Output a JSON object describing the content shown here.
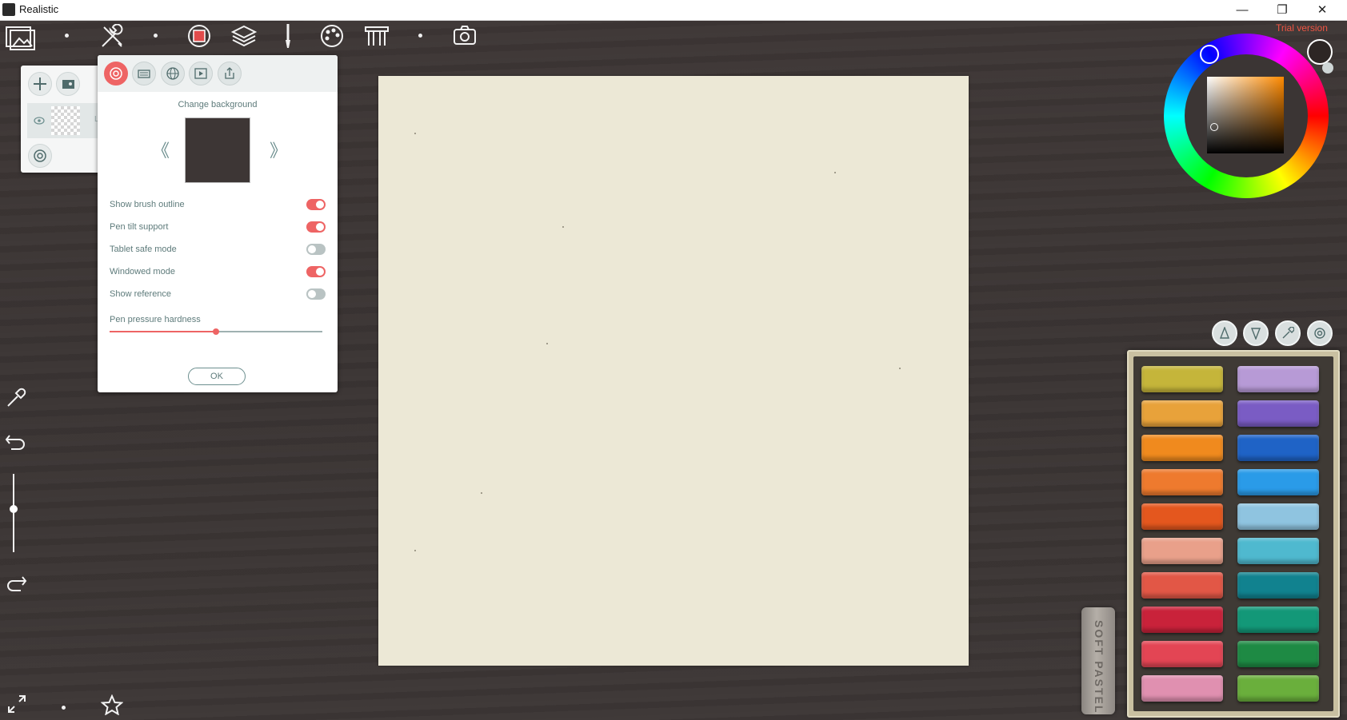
{
  "window": {
    "title": "Realistic",
    "min": "—",
    "max": "❐",
    "close": "✕"
  },
  "trial": "Trial version",
  "layers": {
    "layer_name": "Lay"
  },
  "settings": {
    "bg_label": "Change background",
    "prev": "《",
    "next": "》",
    "options": [
      {
        "label": "Show brush outline",
        "on": true
      },
      {
        "label": "Pen tilt support",
        "on": true
      },
      {
        "label": "Tablet safe mode",
        "on": false
      },
      {
        "label": "Windowed mode",
        "on": true
      },
      {
        "label": "Show reference",
        "on": false
      }
    ],
    "slider_label": "Pen pressure hardness",
    "slider_value": 0.5,
    "ok": "OK"
  },
  "colors": {
    "accent": "#ee6464",
    "current": "#2d2624",
    "canvas": "#ece8d6",
    "background": "#3b3534"
  },
  "pastels": {
    "left": [
      "#c5b53a",
      "#e8a23a",
      "#f08a1e",
      "#ee7a2e",
      "#e4571e",
      "#e9a08a",
      "#e25746",
      "#c9223a",
      "#e34554",
      "#e090b0"
    ],
    "right": [
      "#b79ad6",
      "#7a5cc4",
      "#1f63c6",
      "#2a9be8",
      "#8fc4e0",
      "#4fb9cf",
      "#11828f",
      "#139878",
      "#1e8a44",
      "#6aaf3c"
    ]
  },
  "loose_pastel": "SOFT PASTEL"
}
